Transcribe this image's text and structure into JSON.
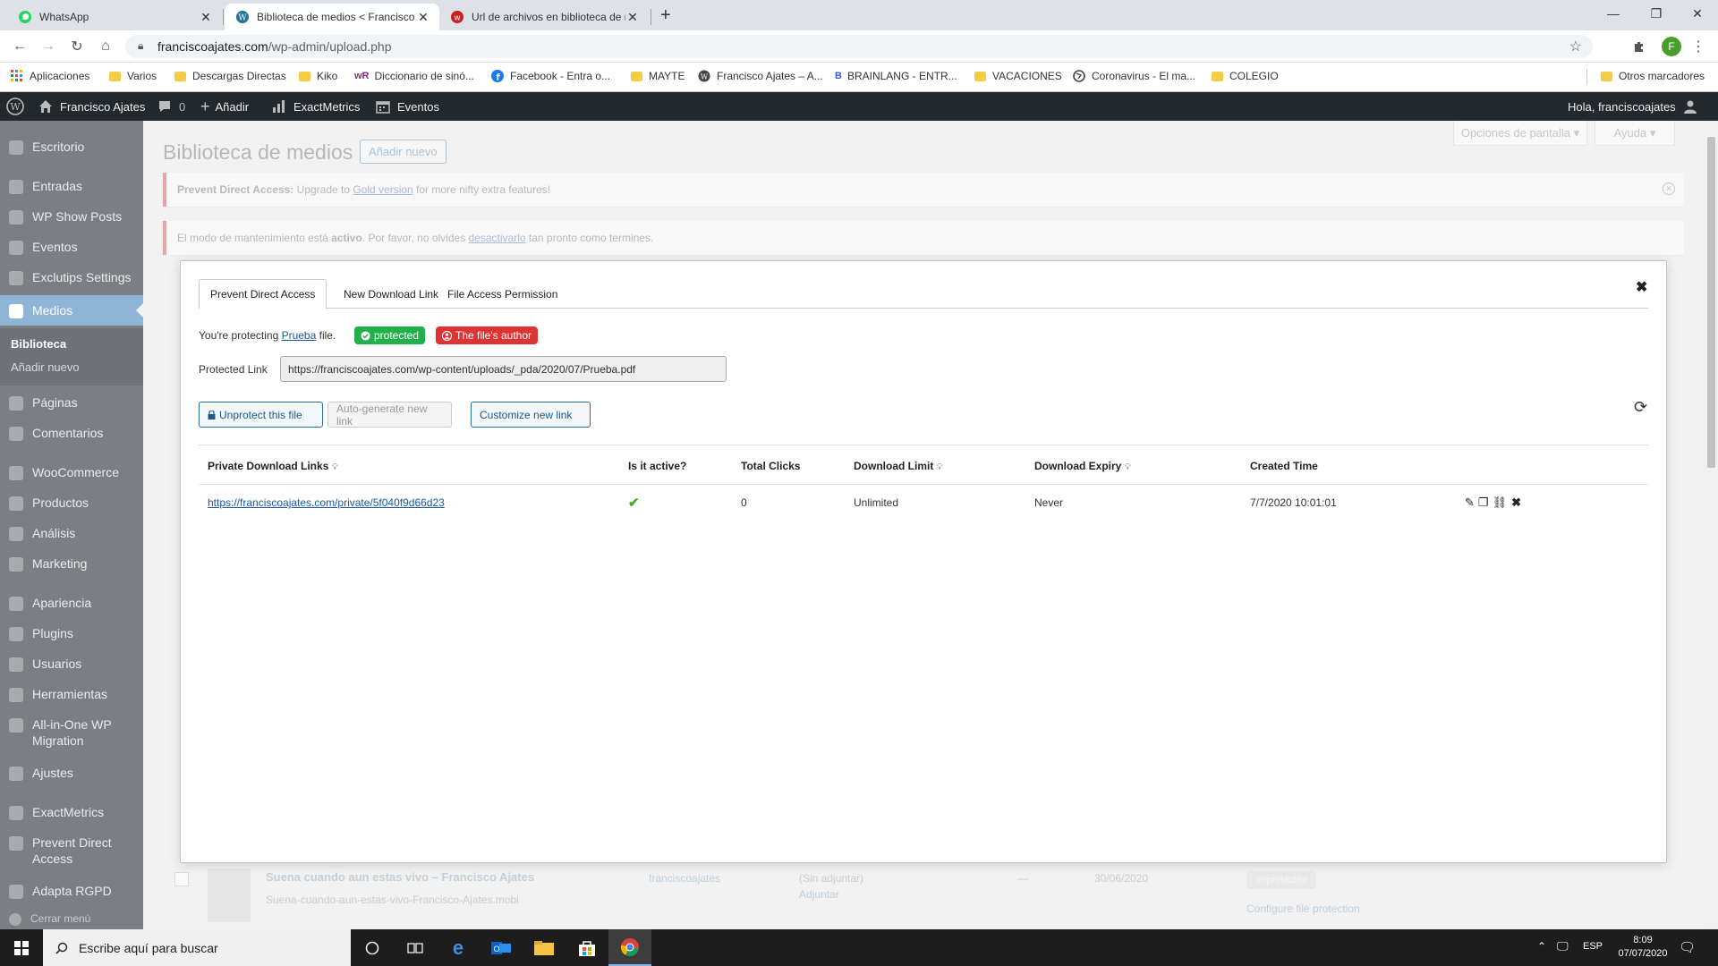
{
  "browser": {
    "tabs": [
      {
        "title": "WhatsApp",
        "icon": "whatsapp-icon"
      },
      {
        "title": "Biblioteca de medios < Francisco",
        "icon": "wordpress-icon"
      },
      {
        "title": "Url de archivos en biblioteca de n",
        "icon": "w-site-icon"
      }
    ],
    "url_host": "franciscoajates.com",
    "url_path": "/wp-admin/upload.php",
    "profile_initial": "F",
    "bookmarks": [
      {
        "label": "Aplicaciones",
        "icon": "apps-grid-icon"
      },
      {
        "label": "Varios",
        "icon": "folder-icon"
      },
      {
        "label": "Descargas Directas",
        "icon": "folder-icon"
      },
      {
        "label": "Kiko",
        "icon": "folder-icon"
      },
      {
        "label": "Diccionario de sinó...",
        "icon": "wr-icon"
      },
      {
        "label": "Facebook - Entra o...",
        "icon": "facebook-icon"
      },
      {
        "label": "MAYTE",
        "icon": "folder-icon"
      },
      {
        "label": "Francisco Ajates – A...",
        "icon": "wordpress-icon"
      },
      {
        "label": "BRAINLANG - ENTR...",
        "icon": "brainlang-icon"
      },
      {
        "label": "VACACIONES",
        "icon": "folder-icon"
      },
      {
        "label": "Coronavirus - El ma...",
        "icon": "globe-icon"
      },
      {
        "label": "COLEGIO",
        "icon": "folder-icon"
      }
    ],
    "other_bookmarks": "Otros marcadores"
  },
  "adminbar": {
    "site": "Francisco Ajates",
    "comments": "0",
    "add": "Añadir",
    "exactmetrics": "ExactMetrics",
    "eventos": "Eventos",
    "greeting": "Hola, franciscoajates"
  },
  "sidebar": {
    "items": [
      {
        "label": "Escritorio"
      },
      {
        "label": "Entradas"
      },
      {
        "label": "WP Show Posts"
      },
      {
        "label": "Eventos"
      },
      {
        "label": "Exclutips Settings"
      },
      {
        "label": "Medios"
      },
      {
        "label": "Páginas"
      },
      {
        "label": "Comentarios"
      },
      {
        "label": "WooCommerce"
      },
      {
        "label": "Productos"
      },
      {
        "label": "Análisis"
      },
      {
        "label": "Marketing"
      },
      {
        "label": "Apariencia"
      },
      {
        "label": "Plugins"
      },
      {
        "label": "Usuarios"
      },
      {
        "label": "Herramientas"
      },
      {
        "label": "All-in-One WP"
      },
      {
        "label": "Migration"
      },
      {
        "label": "Ajustes"
      },
      {
        "label": "ExactMetrics"
      },
      {
        "label": "Prevent Direct"
      },
      {
        "label": "Access"
      },
      {
        "label": "Adapta RGPD"
      },
      {
        "label": "Cerrar menú"
      }
    ],
    "sub": {
      "biblioteca": "Biblioteca",
      "add_new": "Añadir nuevo"
    }
  },
  "page": {
    "title": "Biblioteca de medios",
    "add_new": "Añadir nuevo",
    "screen_options": "Opciones de pantalla",
    "help": "Ayuda",
    "notice1": {
      "bold": "Prevent Direct Access:",
      "pre": " Upgrade to ",
      "link": "Gold version",
      "post": " for more nifty extra features!"
    },
    "notice2": {
      "pre": "El modo de mantenimiento está ",
      "bold": "activo",
      "mid": ". Por favor, no olvides ",
      "link": "desactivarlo",
      "post": " tan pronto como termines."
    },
    "bg_row": {
      "title": "Suena cuando aun estas vivo – Francisco Ajates",
      "filename": "Suena-cuando-aun-estas-vivo-Francisco-Ajates.mobi",
      "author": "franciscoajates",
      "attached": "(Sin adjuntar)",
      "attach": "Adjuntar",
      "comments": "—",
      "date": "30/06/2020",
      "status": "unprotected",
      "config": "Configure file protection"
    }
  },
  "modal": {
    "tabs": [
      "Prevent Direct Access",
      "New Download Link",
      "File Access Permission"
    ],
    "protecting_pre": "You're protecting ",
    "file_name": "Prueba",
    "protecting_post": " file.",
    "badge_protected": "protected",
    "badge_author": "The file's author",
    "protected_link_label": "Protected Link",
    "protected_link_value": "https://franciscoajates.com/wp-content/uploads/_pda/2020/07/Prueba.pdf",
    "buttons": {
      "unprotect": "Unprotect this file",
      "autogen": "Auto-generate new link",
      "customize": "Customize new link"
    },
    "table": {
      "headers": [
        "Private Download Links",
        "Is it active?",
        "Total Clicks",
        "Download Limit",
        "Download Expiry",
        "Created Time"
      ],
      "rows": [
        {
          "link": "https://franciscoajates.com/private/5f040f9d66d23",
          "active": true,
          "clicks": "0",
          "limit": "Unlimited",
          "expiry": "Never",
          "created": "7/7/2020 10:01:01"
        }
      ]
    },
    "colors": {
      "protected": "#21b14a",
      "author": "#dd3333",
      "link": "#1a58a6",
      "check": "#4caf1e"
    }
  },
  "taskbar": {
    "search_placeholder": "Escribe aquí para buscar",
    "lang": "ESP",
    "time": "8:09",
    "date": "07/07/2020"
  }
}
